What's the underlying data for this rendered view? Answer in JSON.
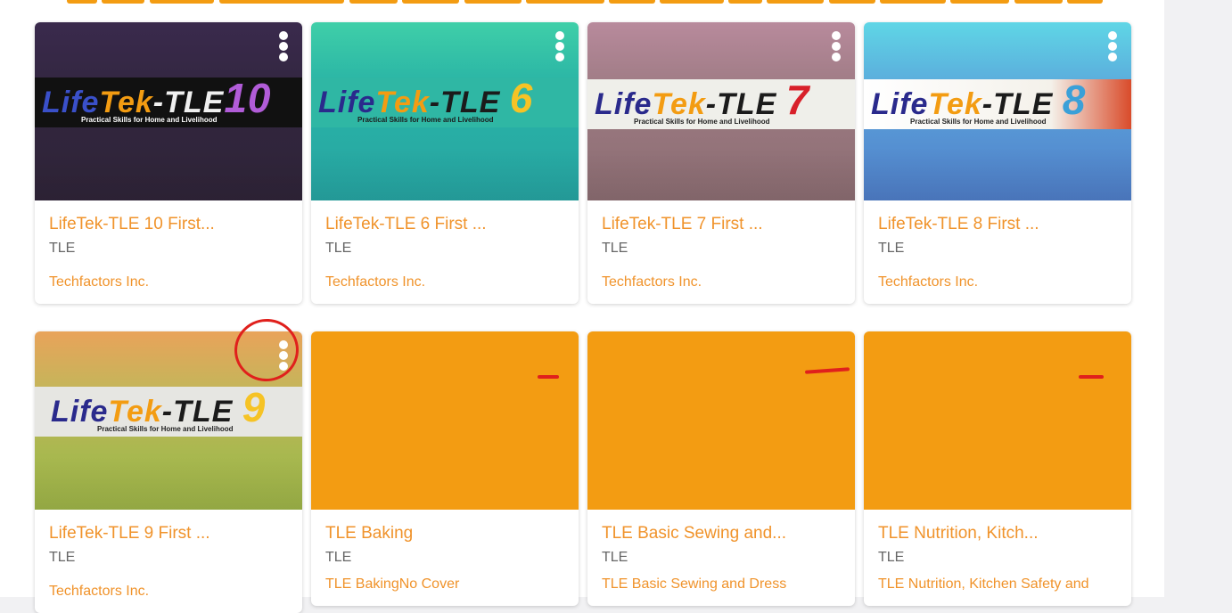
{
  "courses": [
    {
      "title": "LifeTek-TLE 10 First...",
      "subject": "TLE",
      "publisher": "Techfactors Inc.",
      "cover": {
        "brand_life": "Life",
        "brand_tek": "Tek",
        "brand_tle": "-TLE",
        "grade": "10",
        "tagline": "Practical Skills for Home and Livelihood"
      }
    },
    {
      "title": "LifeTek-TLE 6 First ...",
      "subject": "TLE",
      "publisher": "Techfactors Inc.",
      "cover": {
        "brand_life": "Life",
        "brand_tek": "Tek",
        "brand_tle": "-TLE",
        "grade": "6",
        "tagline": "Practical Skills for Home and Livelihood"
      }
    },
    {
      "title": "LifeTek-TLE 7 First ...",
      "subject": "TLE",
      "publisher": "Techfactors Inc.",
      "cover": {
        "brand_life": "Life",
        "brand_tek": "Tek",
        "brand_tle": "-TLE",
        "grade": "7",
        "tagline": "Practical Skills for Home and Livelihood"
      }
    },
    {
      "title": "LifeTek-TLE 8 First ...",
      "subject": "TLE",
      "publisher": "Techfactors Inc.",
      "cover": {
        "brand_life": "Life",
        "brand_tek": "Tek",
        "brand_tle": "-TLE",
        "grade": "8",
        "tagline": "Practical Skills for Home and Livelihood"
      }
    },
    {
      "title": "LifeTek-TLE 9 First ...",
      "subject": "TLE",
      "publisher": "Techfactors Inc.",
      "cover": {
        "brand_life": "Life",
        "brand_tek": "Tek",
        "brand_tle": "-TLE",
        "grade": "9",
        "tagline": "Practical Skills for Home and Livelihood"
      }
    },
    {
      "title": "TLE Baking",
      "subject": "TLE",
      "description": "TLE BakingNo Cover"
    },
    {
      "title": "TLE Basic Sewing and...",
      "subject": "TLE",
      "description": "TLE Basic Sewing and Dress"
    },
    {
      "title": "TLE Nutrition, Kitch...",
      "subject": "TLE",
      "description": "TLE Nutrition, Kitchen Safety and"
    }
  ],
  "colors": {
    "accent": "#f39c12",
    "title_text": "#f0932b",
    "annotation": "#e0201c"
  },
  "icons": {
    "menu": "kebab-menu-icon"
  }
}
